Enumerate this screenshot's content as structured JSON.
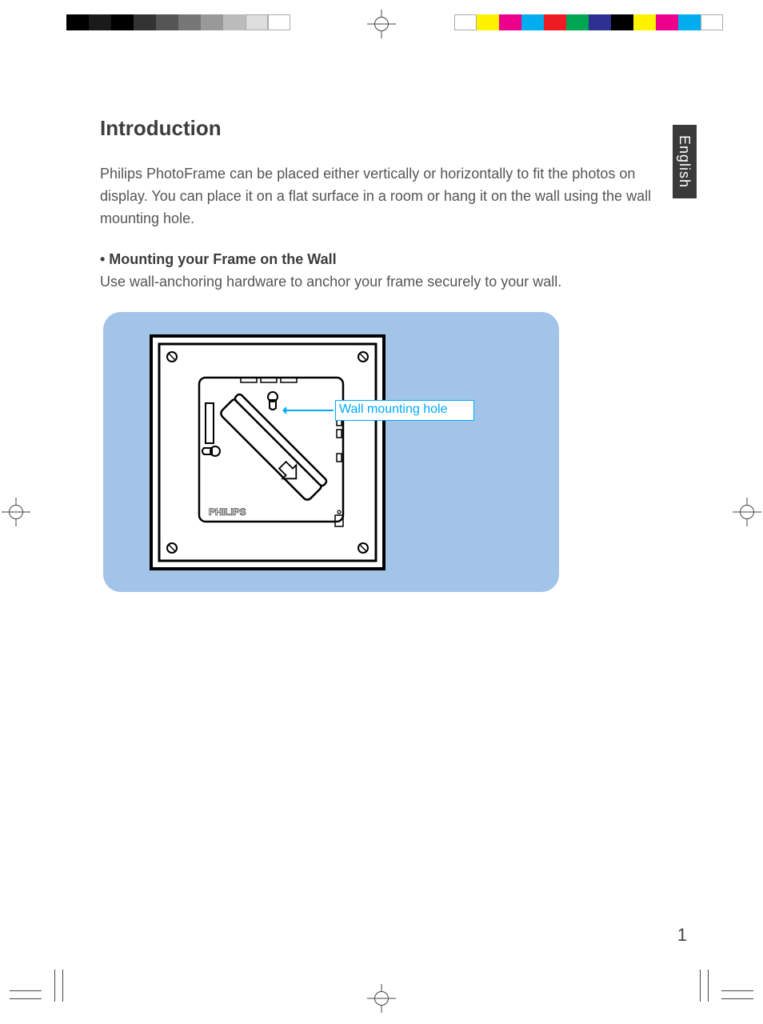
{
  "heading": "Introduction",
  "intro_paragraph": "Philips PhotoFrame can be placed either vertically or horizontally to fit the photos on display. You can place it on a flat surface in a room or hang it on the wall using the wall mounting hole.",
  "subheading": "• Mounting your Frame on the Wall",
  "sub_paragraph": "Use wall-anchoring hardware to anchor your frame securely to your wall.",
  "callout_label": "Wall mounting hole",
  "brand_on_device": "PHILIPS",
  "language_tab": "English",
  "page_number": "1",
  "grayscale_swatches": [
    "#000000",
    "#1a1a1a",
    "#000000",
    "#333333",
    "#555555",
    "#777777",
    "#999999",
    "#bbbbbb",
    "#dddddd",
    "#ffffff"
  ],
  "color_swatches": [
    "#ffffff",
    "#fff200",
    "#ec008c",
    "#00aeef",
    "#ed1c24",
    "#00a651",
    "#2e3192",
    "#000000",
    "#fff200",
    "#ec008c",
    "#00aeef",
    "#ffffff"
  ]
}
